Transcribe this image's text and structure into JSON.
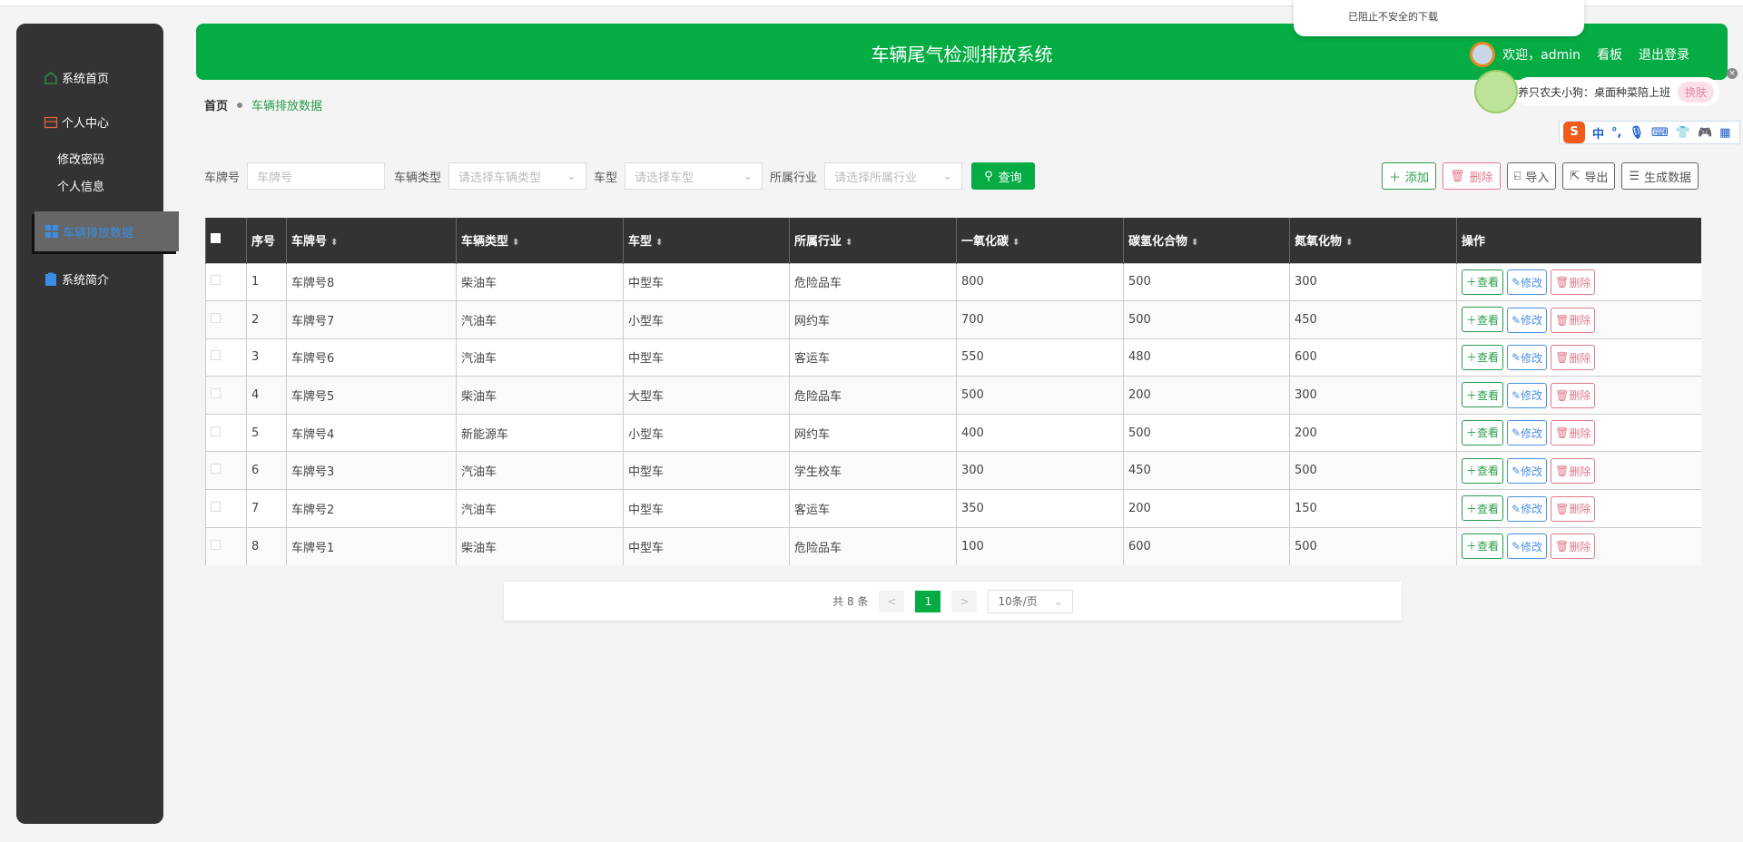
{
  "sidebar": {
    "items": [
      {
        "label": "系统首页",
        "icon": "home-icon"
      },
      {
        "label": "个人中心",
        "icon": "wallet-icon"
      }
    ],
    "sub": [
      "修改密码",
      "个人信息"
    ],
    "active": "车辆排放数据",
    "intro": "系统简介"
  },
  "header": {
    "title": "车辆尾气检测排放系统",
    "welcome": "欢迎，admin",
    "board": "看板",
    "logout": "退出登录"
  },
  "breadcrumb": {
    "home": "首页",
    "current": "车辆排放数据"
  },
  "filters": {
    "plate_label": "车牌号",
    "plate_placeholder": "车牌号",
    "vtype_label": "车辆类型",
    "vtype_placeholder": "请选择车辆类型",
    "model_label": "车型",
    "model_placeholder": "请选择车型",
    "industry_label": "所属行业",
    "industry_placeholder": "请选择所属行业",
    "search": "查询"
  },
  "actions": {
    "add": "添加",
    "delete": "删除",
    "import": "导入",
    "export": "导出",
    "generate": "生成数据"
  },
  "table": {
    "headers": [
      "序号",
      "车牌号",
      "车辆类型",
      "车型",
      "所属行业",
      "一氧化碳",
      "碳氢化合物",
      "氮氧化物",
      "操作"
    ],
    "rows": [
      [
        "1",
        "车牌号8",
        "柴油车",
        "中型车",
        "危险品车",
        "800",
        "500",
        "300"
      ],
      [
        "2",
        "车牌号7",
        "汽油车",
        "小型车",
        "网约车",
        "700",
        "500",
        "450"
      ],
      [
        "3",
        "车牌号6",
        "汽油车",
        "中型车",
        "客运车",
        "550",
        "480",
        "600"
      ],
      [
        "4",
        "车牌号5",
        "柴油车",
        "大型车",
        "危险品车",
        "500",
        "200",
        "300"
      ],
      [
        "5",
        "车牌号4",
        "新能源车",
        "小型车",
        "网约车",
        "400",
        "500",
        "200"
      ],
      [
        "6",
        "车牌号3",
        "汽油车",
        "中型车",
        "学生校车",
        "300",
        "450",
        "500"
      ],
      [
        "7",
        "车牌号2",
        "汽油车",
        "中型车",
        "客运车",
        "350",
        "200",
        "150"
      ],
      [
        "8",
        "车牌号1",
        "柴油车",
        "中型车",
        "危险品车",
        "100",
        "600",
        "500"
      ]
    ],
    "row_actions": {
      "view": "查看",
      "edit": "修改",
      "delete": "删除"
    }
  },
  "pagination": {
    "total": "共 8 条",
    "prev": "<",
    "page": "1",
    "next": ">",
    "size": "10条/页"
  },
  "overlays": {
    "download_notice": "已阻止不安全的下载",
    "pet_text": "养只农夫小狗：桌面种菜陪上班",
    "skin": "换肤",
    "ime_mode": "中"
  },
  "colors": {
    "primary": "#05ac44",
    "sidebar": "#333333",
    "danger": "#e07a8a",
    "info": "#4a90e2"
  }
}
